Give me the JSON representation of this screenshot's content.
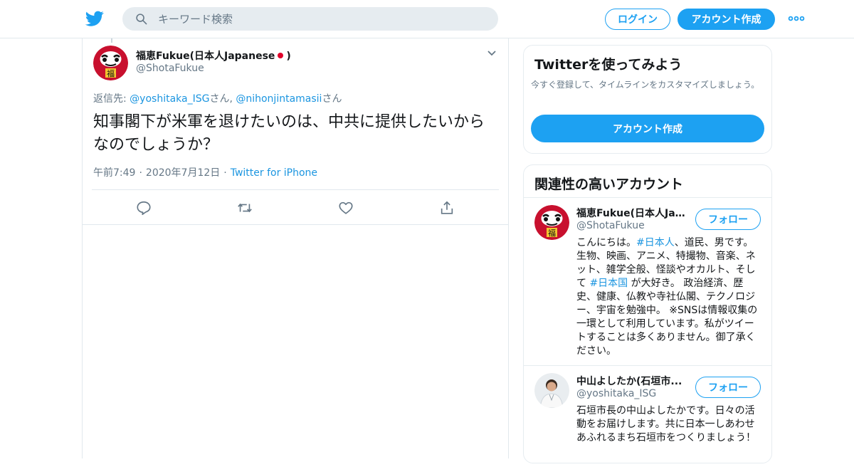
{
  "header": {
    "search_placeholder": "キーワード検索",
    "login_label": "ログイン",
    "signup_label": "アカウント作成",
    "brand_color": "#1da1f2"
  },
  "tweet": {
    "display_name": "福恵Fukue(日本人Japanese",
    "display_name_suffix": ")",
    "handle": "@ShotaFukue",
    "reply_prefix": "返信先: ",
    "reply_user1": "@yoshitaka_ISG",
    "reply_san1": "さん, ",
    "reply_user2": "@nihonjintamasii",
    "reply_san2": "さん",
    "text": "知事閣下が米軍を退けたいのは、中共に提供したいからなのでしょうか？",
    "time": "午前7:49",
    "date": "2020年7月12日",
    "source": "Twitter for iPhone",
    "meta_sep": "·"
  },
  "signup_card": {
    "title": "Twitterを使ってみよう",
    "desc": "今すぐ登録して、タイムラインをカスタマイズしましょう。",
    "button": "アカウント作成"
  },
  "related": {
    "title": "関連性の高いアカウント",
    "accounts": [
      {
        "name": "福恵Fukue(日本人Jap...",
        "handle": "@ShotaFukue",
        "follow": "フォロー",
        "bio_1": "こんにちは。",
        "bio_tag1": "#日本人",
        "bio_2": "、道民、男です。 生物、映画、アニメ、特撮物、音楽、ネット、雑学全般、怪談やオカルト、そして ",
        "bio_tag2": "#日本国",
        "bio_3": " が大好き。 政治経済、歴史、健康、仏教や寺社仏閣、テクノロジー、宇宙を勉強中。 ※SNSは情報収集の一環として利用しています。私がツイートすることは多くありません。御了承ください。"
      },
      {
        "name": "中山よしたか(石垣市...",
        "handle": "@yoshitaka_ISG",
        "follow": "フォロー",
        "bio": "石垣市長の中山よしたかです。日々の活動をお届けします。共に日本一しあわせあふれるまち石垣市をつくりましょう！"
      }
    ]
  }
}
